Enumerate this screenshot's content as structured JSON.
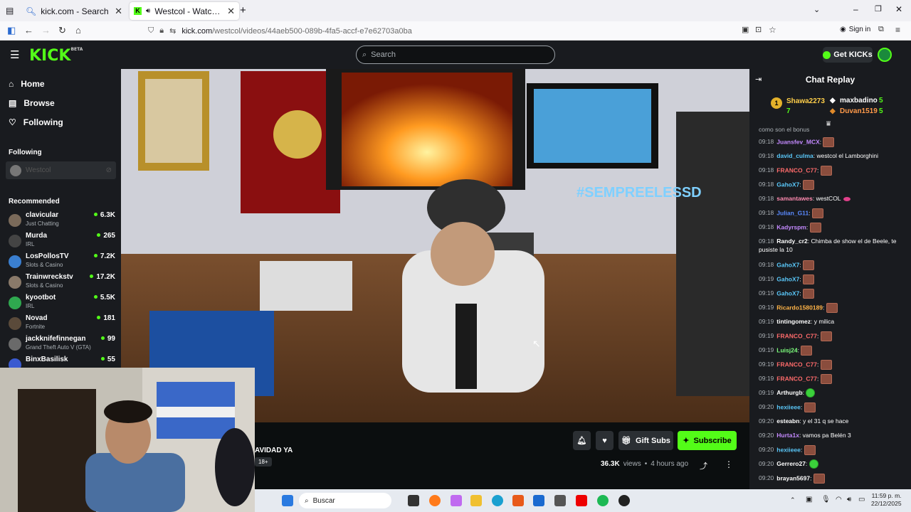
{
  "browser": {
    "tabs": [
      {
        "title": "kick.com - Search",
        "active": false
      },
      {
        "title": "Westcol - Watch the VOD o",
        "active": true
      }
    ],
    "url_host": "kick.com",
    "url_path": "/westcol/videos/44aeb500-089b-4fa5-accf-e7e62703a0ba",
    "signin_label": "Sign in"
  },
  "header": {
    "logo": "KICK",
    "logo_badge": "BETA",
    "search_placeholder": "Search",
    "get_kicks_label": "Get KICKs"
  },
  "sidebar": {
    "nav": [
      {
        "label": "Home",
        "icon": "home-icon"
      },
      {
        "label": "Browse",
        "icon": "browse-icon"
      },
      {
        "label": "Following",
        "icon": "heart-icon"
      }
    ],
    "following_heading": "Following",
    "followed_channel": "Westcol",
    "recommended_heading": "Recommended",
    "recommended": [
      {
        "name": "clavicular",
        "category": "Just Chatting",
        "viewers": "6.3K",
        "color": "#7a6a5a"
      },
      {
        "name": "Murda",
        "category": "IRL",
        "viewers": "265",
        "color": "#444"
      },
      {
        "name": "LosPollosTV",
        "category": "Slots & Casino",
        "viewers": "7.2K",
        "color": "#3a7fd0"
      },
      {
        "name": "Trainwreckstv",
        "category": "Slots & Casino",
        "viewers": "17.2K",
        "color": "#8a7a6a"
      },
      {
        "name": "kyootbot",
        "category": "IRL",
        "viewers": "5.5K",
        "color": "#2fa84f"
      },
      {
        "name": "Novad",
        "category": "Fortnite",
        "viewers": "181",
        "color": "#5a4a3a"
      },
      {
        "name": "jackknifefinnegan",
        "category": "Grand Theft Auto V (GTA)",
        "viewers": "99",
        "color": "#6a6a6a"
      },
      {
        "name": "BinxBasilisk",
        "category": "",
        "viewers": "55",
        "color": "#3a5ad0"
      }
    ]
  },
  "video": {
    "title_fragment": "AVIDAD YA",
    "rating_badge": "18+",
    "views": "36.3K",
    "views_suffix": "views",
    "separator": "•",
    "age": "4 hours ago",
    "gift_subs_label": "Gift Subs",
    "subscribe_label": "Subscribe",
    "overlay_text": "#SEMPREELESSD"
  },
  "chat": {
    "heading": "Chat Replay",
    "leaderboard": [
      {
        "rank": "1",
        "name": "Shawa2273",
        "count": "7"
      },
      {
        "name": "maxbadino",
        "count": "5"
      },
      {
        "name": "Duvan1519",
        "count": "5"
      }
    ],
    "partial_line": "como son el bonus",
    "messages": [
      {
        "time": "09:18",
        "user": "Juansfev_MCX",
        "color": "#c48aff",
        "text": "",
        "emote": "brown"
      },
      {
        "time": "09:18",
        "user": "david_culma",
        "color": "#5ac8fa",
        "text": "westcol el Lamborghini",
        "emote": ""
      },
      {
        "time": "09:18",
        "user": "FRANCO_C77",
        "color": "#ff6b6b",
        "text": "",
        "emote": "brown"
      },
      {
        "time": "09:18",
        "user": "GahoX7",
        "color": "#5ac8fa",
        "text": "",
        "emote": "brown"
      },
      {
        "time": "09:18",
        "user": "samantawes",
        "color": "#ff8ab0",
        "text": "westCOL",
        "emote": "lips"
      },
      {
        "time": "09:18",
        "user": "Julian_G11",
        "color": "#5a8aff",
        "text": "",
        "emote": "brown"
      },
      {
        "time": "09:18",
        "user": "Kadyrspm",
        "color": "#c48aff",
        "text": "",
        "emote": "brown"
      },
      {
        "time": "09:18",
        "user": "Randy_cr2",
        "color": "#ffffff",
        "text": "Chimba de show el de Beele, te pusiste la 10",
        "emote": ""
      },
      {
        "time": "09:18",
        "user": "GahoX7",
        "color": "#5ac8fa",
        "text": "",
        "emote": "brown"
      },
      {
        "time": "09:19",
        "user": "GahoX7",
        "color": "#5ac8fa",
        "text": "",
        "emote": "brown"
      },
      {
        "time": "09:19",
        "user": "GahoX7",
        "color": "#5ac8fa",
        "text": "",
        "emote": "brown"
      },
      {
        "time": "09:19",
        "user": "Ricardo1580189",
        "color": "#ffb347",
        "text": "",
        "emote": "brown"
      },
      {
        "time": "09:19",
        "user": "tintingomez",
        "color": "#ffffff",
        "text": "y milica",
        "emote": ""
      },
      {
        "time": "09:19",
        "user": "FRANCO_C77",
        "color": "#ff6b6b",
        "text": "",
        "emote": "brown"
      },
      {
        "time": "09:19",
        "user": "Luisj24",
        "color": "#7dff7d",
        "text": "",
        "emote": "brown"
      },
      {
        "time": "09:19",
        "user": "FRANCO_C77",
        "color": "#ff6b6b",
        "text": "",
        "emote": "brown"
      },
      {
        "time": "09:19",
        "user": "FRANCO_C77",
        "color": "#ff6b6b",
        "text": "",
        "emote": "brown"
      },
      {
        "time": "09:19",
        "user": "Arthurgb",
        "color": "#ffffff",
        "text": "",
        "emote": "green"
      },
      {
        "time": "09:20",
        "user": "hexiieee",
        "color": "#5ac8fa",
        "text": "",
        "emote": "brown"
      },
      {
        "time": "09:20",
        "user": "esteabn",
        "color": "#ffffff",
        "text": "y el 31 q se hace",
        "emote": ""
      },
      {
        "time": "09:20",
        "user": "Hurta1x",
        "color": "#c48aff",
        "text": "vamos pa Belén 3",
        "emote": ""
      },
      {
        "time": "09:20",
        "user": "hexiieee",
        "color": "#5ac8fa",
        "text": "",
        "emote": "brown"
      },
      {
        "time": "09:20",
        "user": "Gerrero27",
        "color": "#ffffff",
        "text": "",
        "emote": "green"
      },
      {
        "time": "09:20",
        "user": "brayan5697",
        "color": "#ffffff",
        "text": "",
        "emote": "brown"
      }
    ]
  },
  "taskbar": {
    "search_label": "Buscar",
    "clock_time": "11:59 p. m.",
    "clock_date": "22/12/2025"
  },
  "colors": {
    "brand": "#53fc18",
    "header_bg": "#191b1f",
    "page_bg": "#0b0e0f"
  }
}
